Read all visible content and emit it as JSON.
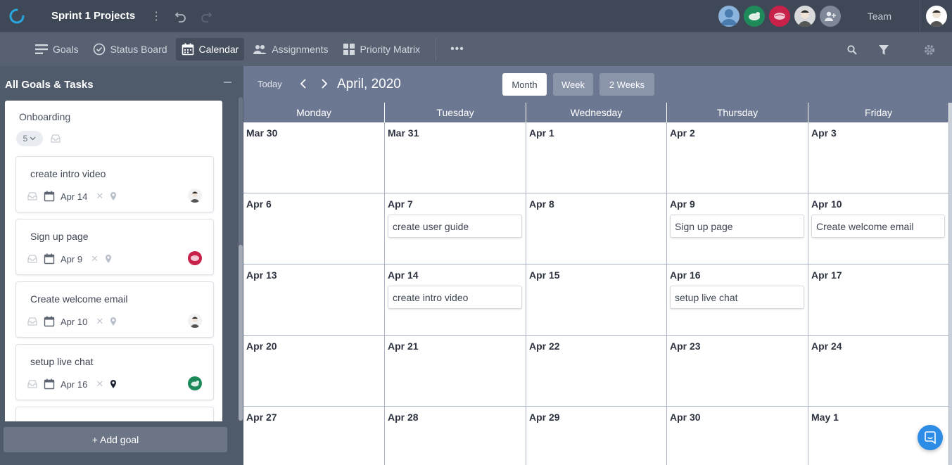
{
  "header": {
    "project_title": "Sprint 1 Projects",
    "team_label": "Team"
  },
  "nav": {
    "goals": "Goals",
    "status_board": "Status Board",
    "calendar": "Calendar",
    "assignments": "Assignments",
    "priority_matrix": "Priority Matrix",
    "more": "•••"
  },
  "sidebar": {
    "header": "All Goals & Tasks",
    "goal": {
      "title": "Onboarding",
      "count": "5"
    },
    "tasks": [
      {
        "name": "create intro video",
        "date": "Apr 14"
      },
      {
        "name": "Sign up page",
        "date": "Apr 9"
      },
      {
        "name": "Create welcome email",
        "date": "Apr 10"
      },
      {
        "name": "setup live chat",
        "date": "Apr 16"
      }
    ],
    "add_goal": "+ Add goal"
  },
  "calendar": {
    "today": "Today",
    "month_label": "April, 2020",
    "views": {
      "month": "Month",
      "week": "Week",
      "two_weeks": "2 Weeks"
    },
    "active_view": "Month",
    "days": [
      "Monday",
      "Tuesday",
      "Wednesday",
      "Thursday",
      "Friday"
    ],
    "weeks": [
      [
        "Mar 30",
        "Mar 31",
        "Apr 1",
        "Apr 2",
        "Apr 3"
      ],
      [
        "Apr 6",
        "Apr 7",
        "Apr 8",
        "Apr 9",
        "Apr 10"
      ],
      [
        "Apr 13",
        "Apr 14",
        "Apr 15",
        "Apr 16",
        "Apr 17"
      ],
      [
        "Apr 20",
        "Apr 21",
        "Apr 22",
        "Apr 23",
        "Apr 24"
      ],
      [
        "Apr 27",
        "Apr 28",
        "Apr 29",
        "Apr 30",
        "May 1"
      ]
    ],
    "events": [
      {
        "date": "Apr 7",
        "title": "create user guide"
      },
      {
        "date": "Apr 9",
        "title": "Sign up page"
      },
      {
        "date": "Apr 10",
        "title": "Create welcome email"
      },
      {
        "date": "Apr 14",
        "title": "create intro video"
      },
      {
        "date": "Apr 16",
        "title": "setup live chat"
      }
    ]
  },
  "colors": {
    "topbar": "#3f4857",
    "navbar": "#576172",
    "calendar_header": "#6c7891",
    "accent_blue": "#2d8ce6",
    "avatar_green": "#1e8a5a",
    "avatar_red": "#c8224b"
  }
}
